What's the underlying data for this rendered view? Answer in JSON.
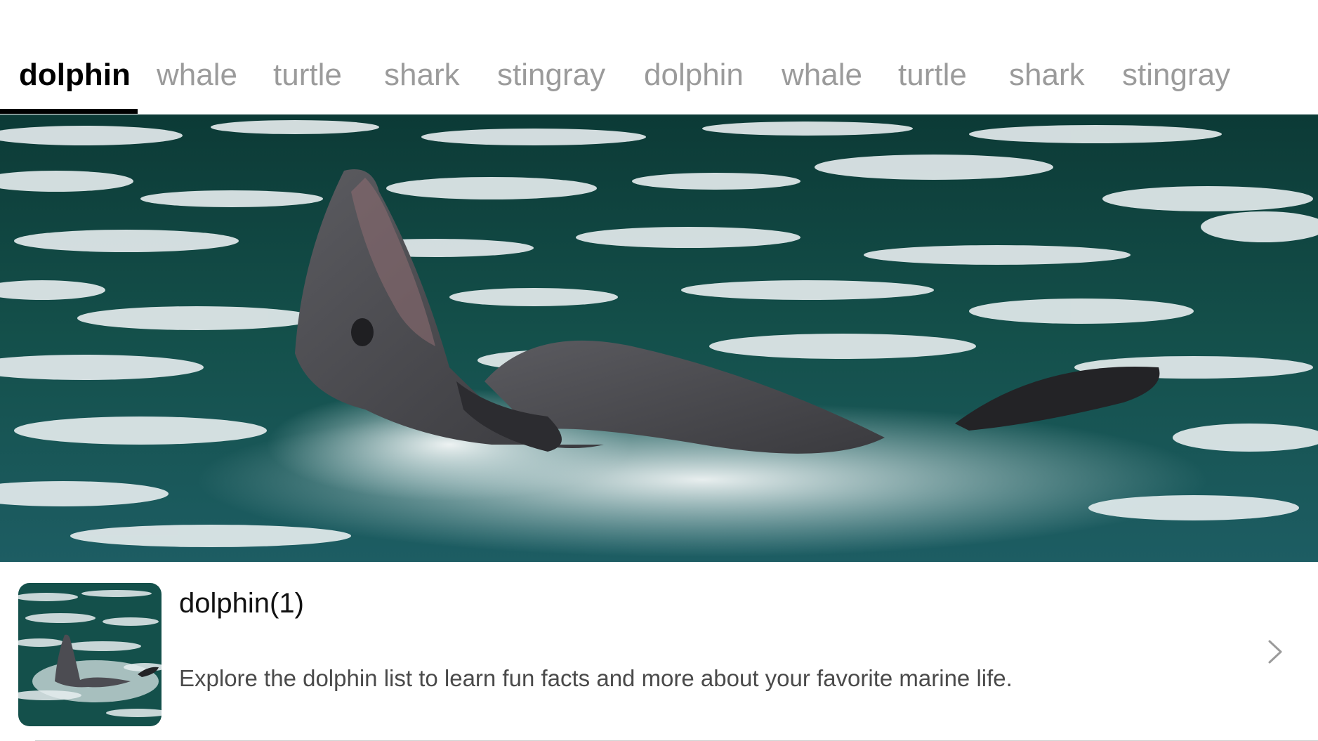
{
  "tabs": [
    {
      "label": "dolphin",
      "active": true
    },
    {
      "label": "whale",
      "active": false
    },
    {
      "label": "turtle",
      "active": false
    },
    {
      "label": "shark",
      "active": false
    },
    {
      "label": "stingray",
      "active": false
    },
    {
      "label": "dolphin",
      "active": false
    },
    {
      "label": "whale",
      "active": false
    },
    {
      "label": "turtle",
      "active": false
    },
    {
      "label": "shark",
      "active": false
    },
    {
      "label": "stingray",
      "active": false
    }
  ],
  "colors": {
    "active_tab": "#000000",
    "inactive_tab": "#9b9b9b",
    "water": "#0f3f3c",
    "divider": "#d0d0d0"
  },
  "list": [
    {
      "title": "dolphin(1)",
      "description": "Explore the dolphin list to learn fun facts and more about your favorite marine life.",
      "icon": "chevron-right-icon"
    }
  ]
}
